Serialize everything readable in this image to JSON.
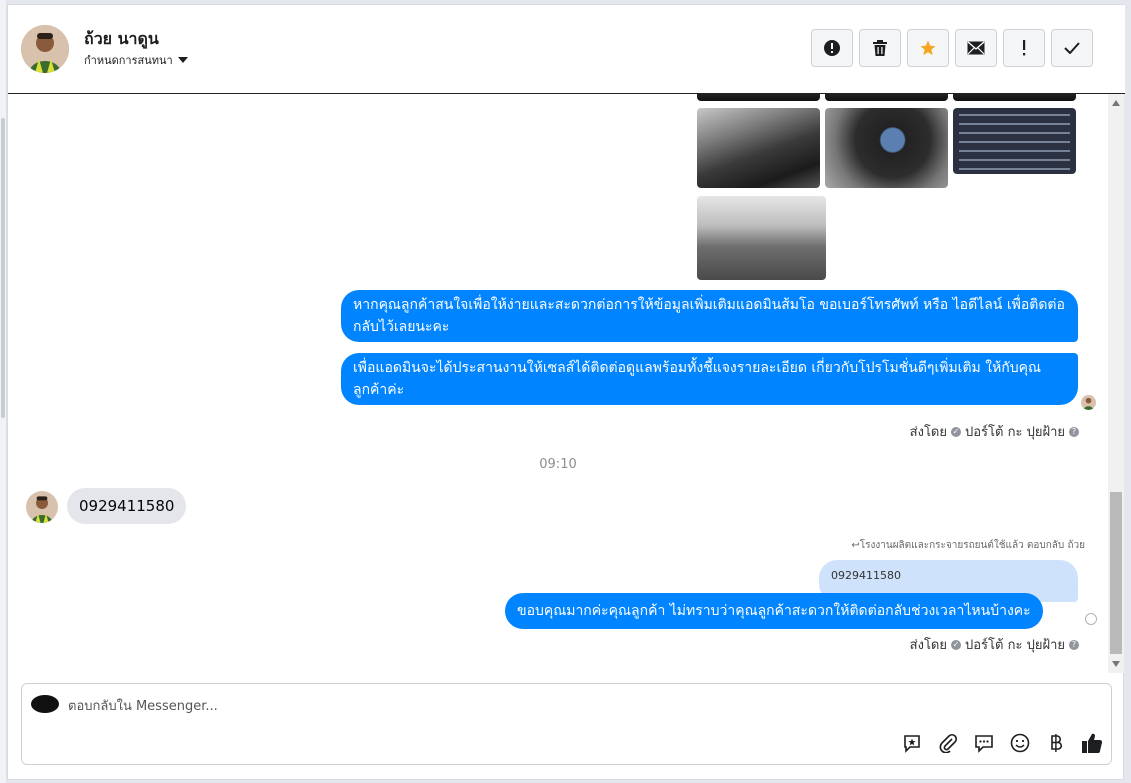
{
  "header": {
    "contact_name": "ถ้วย นาดูน",
    "subtitle": "กำหนดการสนทนา",
    "toolbar": [
      {
        "name": "alert-circle-icon"
      },
      {
        "name": "trash-icon"
      },
      {
        "name": "star-icon",
        "color": "#f5a623"
      },
      {
        "name": "envelope-icon"
      },
      {
        "name": "exclamation-icon"
      },
      {
        "name": "check-icon"
      }
    ]
  },
  "messages": {
    "outgoing_1": "หากคุณลูกค้าสนใจเพื่อให้ง่ายและสะดวกต่อการให้ข้อมูลเพิ่มเติมแอดมินส้มโอ ขอเบอร์โทรศัพท์ หรือ ไอดีไลน์ เพื่อติดต่อกลับไว้เลยนะคะ",
    "outgoing_2": "เพื่อแอดมินจะได้ประสานงานให้เซลส์ได้ติดต่อดูแลพร้อมทั้งชี้แจงรายละเอียด เกี่ยวกับโปรโมชั่นดีๆเพิ่มเติม ให้กับคุณลูกค้าค่ะ",
    "sent_by_label": "ส่งโดย",
    "sender_name": "ปอร์โต้ กะ ปุยฝ้าย",
    "time_divider": "09:10",
    "incoming_1": "0929411580",
    "reply_note": "โรงงานผลิตและกระจายรถยนต์ใช้แล้ว ตอบกลับ ถ้วย",
    "quoted_text": "0929411580",
    "outgoing_reply": "ขอบคุณมากค่ะคุณลูกค้า ไม่ทราบว่าคุณลูกค้าสะดวกให้ติดต่อกลับช่วงเวลาไหนบ้างคะ"
  },
  "composer": {
    "placeholder": "ตอบกลับใน Messenger...",
    "tools": [
      "saved-reply-icon",
      "attachment-icon",
      "chat-bubble-icon",
      "emoji-icon",
      "baht-icon",
      "thumbs-up-icon"
    ]
  },
  "colors": {
    "outgoing_bubble": "#0084ff",
    "incoming_bubble": "#e4e6eb",
    "quoted_bubble": "#cfe2fb"
  }
}
